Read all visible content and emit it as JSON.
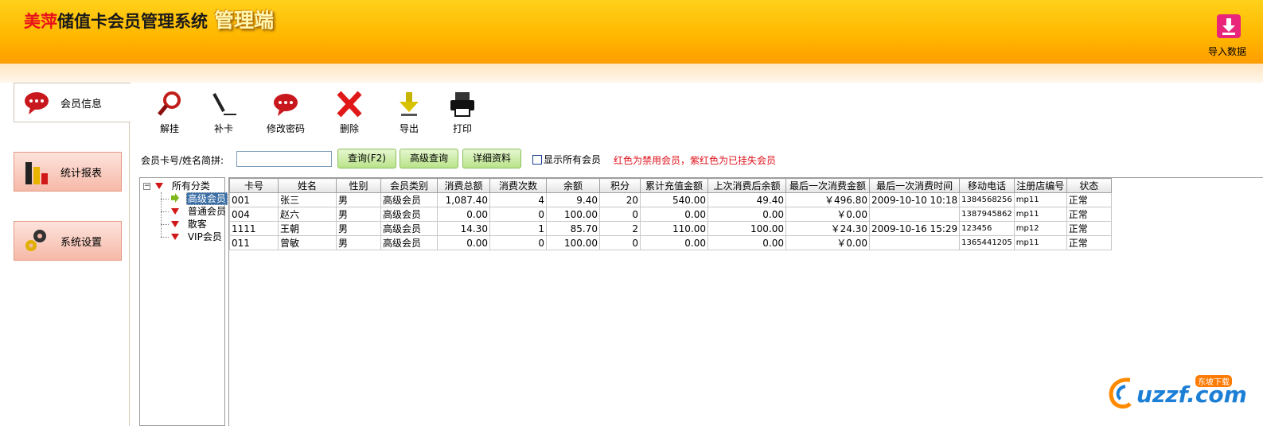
{
  "header": {
    "brand_red": "美萍",
    "brand_dark": "储值卡会员管理系统",
    "brand_tag": "管理端",
    "import_label": "导入数据"
  },
  "nav": [
    {
      "label": "会员信息",
      "icon": "speech-bubble-icon",
      "active": true
    },
    {
      "label": "统计报表",
      "icon": "bar-chart-icon",
      "active": false
    },
    {
      "label": "系统设置",
      "icon": "gear-icon",
      "active": false
    }
  ],
  "toolbar": {
    "items": [
      {
        "label": "解挂",
        "icon": "magnifier-icon"
      },
      {
        "label": "补卡",
        "icon": "pen-icon"
      },
      {
        "label": "修改密码",
        "icon": "speech-bubble-icon"
      },
      {
        "label": "删除",
        "icon": "red-x-icon"
      },
      {
        "label": "导出",
        "icon": "down-arrow-icon"
      },
      {
        "label": "打印",
        "icon": "printer-icon"
      }
    ]
  },
  "search": {
    "label": "会员卡号/姓名简拼:",
    "value": "",
    "query_button": "查询(F2)",
    "advanced_button": "高级查询",
    "details_button": "详细资料",
    "show_all_label": "显示所有会员",
    "show_all_checked": false,
    "notice": "红色为禁用会员，紫红色为已挂失会员"
  },
  "tree": {
    "root": "所有分类",
    "items": [
      "高级会员",
      "普通会员",
      "散客",
      "VIP会员"
    ],
    "selected": "高级会员"
  },
  "grid": {
    "columns": [
      "卡号",
      "姓名",
      "性别",
      "会员类别",
      "消费总额",
      "消费次数",
      "余额",
      "积分",
      "累计充值金额",
      "上次消费后余额",
      "最后一次消费金额",
      "最后一次消费时间",
      "移动电话",
      "注册店编号",
      "状态"
    ],
    "rows": [
      [
        "001",
        "张三",
        "男",
        "高级会员",
        "1,087.40",
        "4",
        "9.40",
        "20",
        "540.00",
        "49.40",
        "￥496.80",
        "2009-10-10 10:18",
        "1384568256",
        "mp11",
        "正常"
      ],
      [
        "004",
        "赵六",
        "男",
        "高级会员",
        "0.00",
        "0",
        "100.00",
        "0",
        "0.00",
        "0.00",
        "￥0.00",
        "",
        "1387945862",
        "mp11",
        "正常"
      ],
      [
        "1111",
        "王朝",
        "男",
        "高级会员",
        "14.30",
        "1",
        "85.70",
        "2",
        "110.00",
        "100.00",
        "￥24.30",
        "2009-10-16 15:29",
        "123456",
        "mp12",
        "正常"
      ],
      [
        "011",
        "曾敏",
        "男",
        "高级会员",
        "0.00",
        "0",
        "100.00",
        "0",
        "0.00",
        "0.00",
        "￥0.00",
        "",
        "1365441205",
        "mp11",
        "正常"
      ]
    ]
  },
  "watermark": {
    "text": "uzzf.com",
    "badge": "东坡下载"
  }
}
